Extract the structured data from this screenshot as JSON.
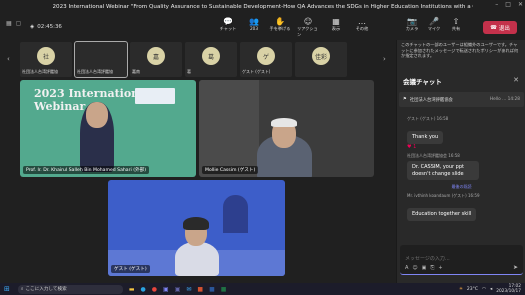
{
  "window": {
    "title": "2023 International Webinar \"From Quality Assurance to Sustainable Development-How QA Advances the SDGs in Higher Education Institutions with a Global A..."
  },
  "meeting": {
    "timer": "02:45:36",
    "participant_count": "203",
    "toolbar": [
      {
        "name": "chat-button",
        "icon": "💬",
        "label": "チャット"
      },
      {
        "name": "people-button",
        "icon": "👥",
        "label": "203"
      },
      {
        "name": "raise-hand-button",
        "icon": "✋",
        "label": "手を挙げる"
      },
      {
        "name": "reactions-button",
        "icon": "☺",
        "label": "リアクション"
      },
      {
        "name": "view-button",
        "icon": "▦",
        "label": "表示"
      },
      {
        "name": "more-button",
        "icon": "…",
        "label": "その他"
      },
      {
        "name": "camera-button",
        "icon": "📷",
        "label": "カメラ"
      },
      {
        "name": "mic-button",
        "icon": "🎤",
        "label": "マイク"
      },
      {
        "name": "share-button",
        "icon": "⇧",
        "label": "共有"
      }
    ],
    "leave_label": "退出"
  },
  "strip": [
    {
      "initial": "社",
      "name": "社団法人台湾評鑑協"
    },
    {
      "initial": "",
      "name": "社団法人台湾評鑑協"
    },
    {
      "initial": "嘉",
      "name": "嘉南"
    },
    {
      "initial": "葛",
      "name": "葛"
    },
    {
      "initial": "ゲ",
      "name": "ゲスト (ゲスト)"
    },
    {
      "initial": "佳彩",
      "name": ""
    }
  ],
  "videos": [
    {
      "name": "Prof. Ir. Dr. Khairul Salleh Bin Mohamed Sahari (外部)",
      "banner": "2023 International Webinar"
    },
    {
      "name": "Mollie Cassim (ゲスト)"
    },
    {
      "name": "ゲスト (ゲスト)"
    }
  ],
  "chat": {
    "notice": "このチャットの一部のユーザーは組織外のユーザーです。チャットに参加されたメッセージで転送されたポリシーがあれば何か指定されます。",
    "title": "会議チャット",
    "pinned": "社団法人台湾評鑑協会",
    "pinned_preview": "Hello ... 14:28",
    "messages": [
      {
        "meta": "ゲスト (ゲスト) 16:58",
        "text": "Thank you",
        "reaction": "♥ 1"
      },
      {
        "meta": "社団法人台湾評鑑協会 16:58",
        "text": "Dr. CASSIM, your ppt doesn't change slide",
        "reaction": ""
      }
    ],
    "separator": "最後の既読",
    "last_meta": "Mr. ivthinh koandaum (ゲスト) 16:59",
    "last_text": "Education together skill",
    "input_placeholder": "メッセージの入力..."
  },
  "taskbar": {
    "search_placeholder": "ここに入力して検索",
    "weather": "23°C",
    "time": "17:02",
    "date": "2023/10/17"
  },
  "colors": {
    "leave": "#c4314b",
    "accent": "#7f85f5",
    "video1": "#53a98e",
    "video3": "#3d5ec9"
  }
}
